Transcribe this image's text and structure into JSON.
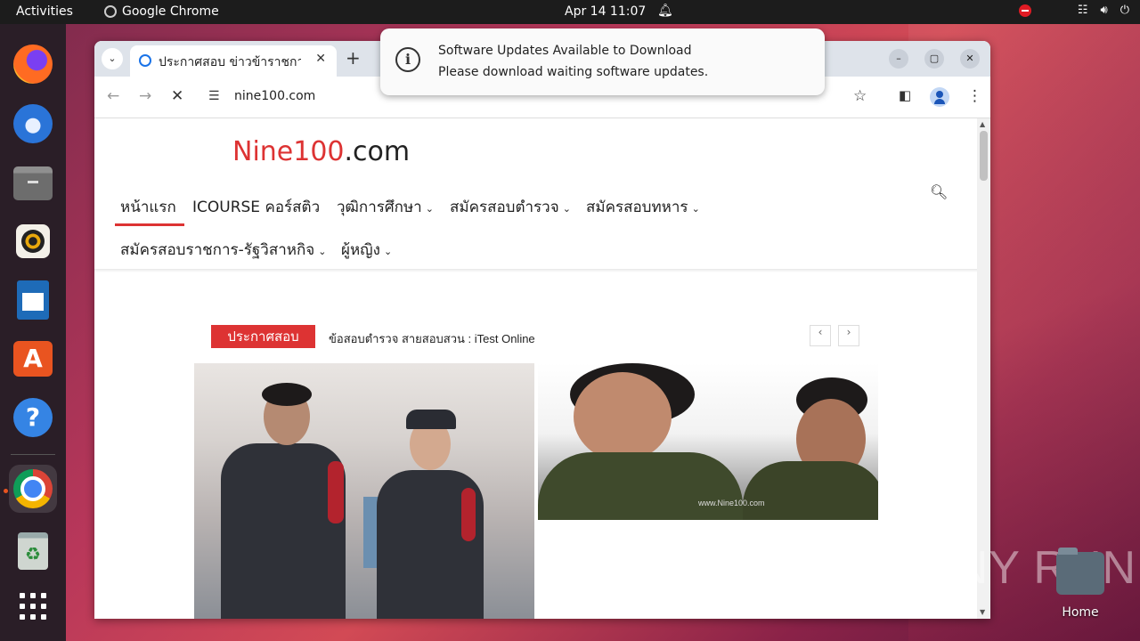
{
  "topbar": {
    "activities": "Activities",
    "app_name": "Google Chrome",
    "clock": "Apr 14  11:07"
  },
  "dock": {
    "items": [
      "firefox-icon",
      "thunderbird-icon",
      "files-icon",
      "rhythmbox-icon",
      "libreoffice-writer-icon",
      "app-center-icon",
      "help-icon",
      "chrome-icon",
      "trash-icon",
      "app-grid-icon"
    ]
  },
  "browser": {
    "tab_title": "ประกาศสอบ ข่าวข้าราชการ",
    "url": "nine100.com"
  },
  "notification": {
    "title": "Software Updates Available to Download",
    "body": "Please download waiting software updates."
  },
  "site": {
    "logo_main": "Nine100",
    "logo_tld": ".com",
    "nav": [
      {
        "label": "หน้าแรก",
        "dropdown": false
      },
      {
        "label": "ICOURSE คอร์สติว",
        "dropdown": false
      },
      {
        "label": "วุฒิการศึกษา",
        "dropdown": true
      },
      {
        "label": "สมัครสอบตำรวจ",
        "dropdown": true
      },
      {
        "label": "สมัครสอบทหาร",
        "dropdown": true
      },
      {
        "label": "สมัครสอบราชการ-รัฐวิสาหกิจ",
        "dropdown": true
      },
      {
        "label": "ผู้หญิง",
        "dropdown": true
      }
    ],
    "news_badge": "ประกาศสอบ",
    "news_ticker": "ข้อสอบตำรวจ สายสอบสวน : iTest Online",
    "image_watermark": "www.Nine100.com"
  },
  "desktop": {
    "home_label": "Home",
    "watermark": "ANY RUN"
  },
  "colors": {
    "accent_red": "#dd3333",
    "ubuntu_orange": "#e95420"
  }
}
